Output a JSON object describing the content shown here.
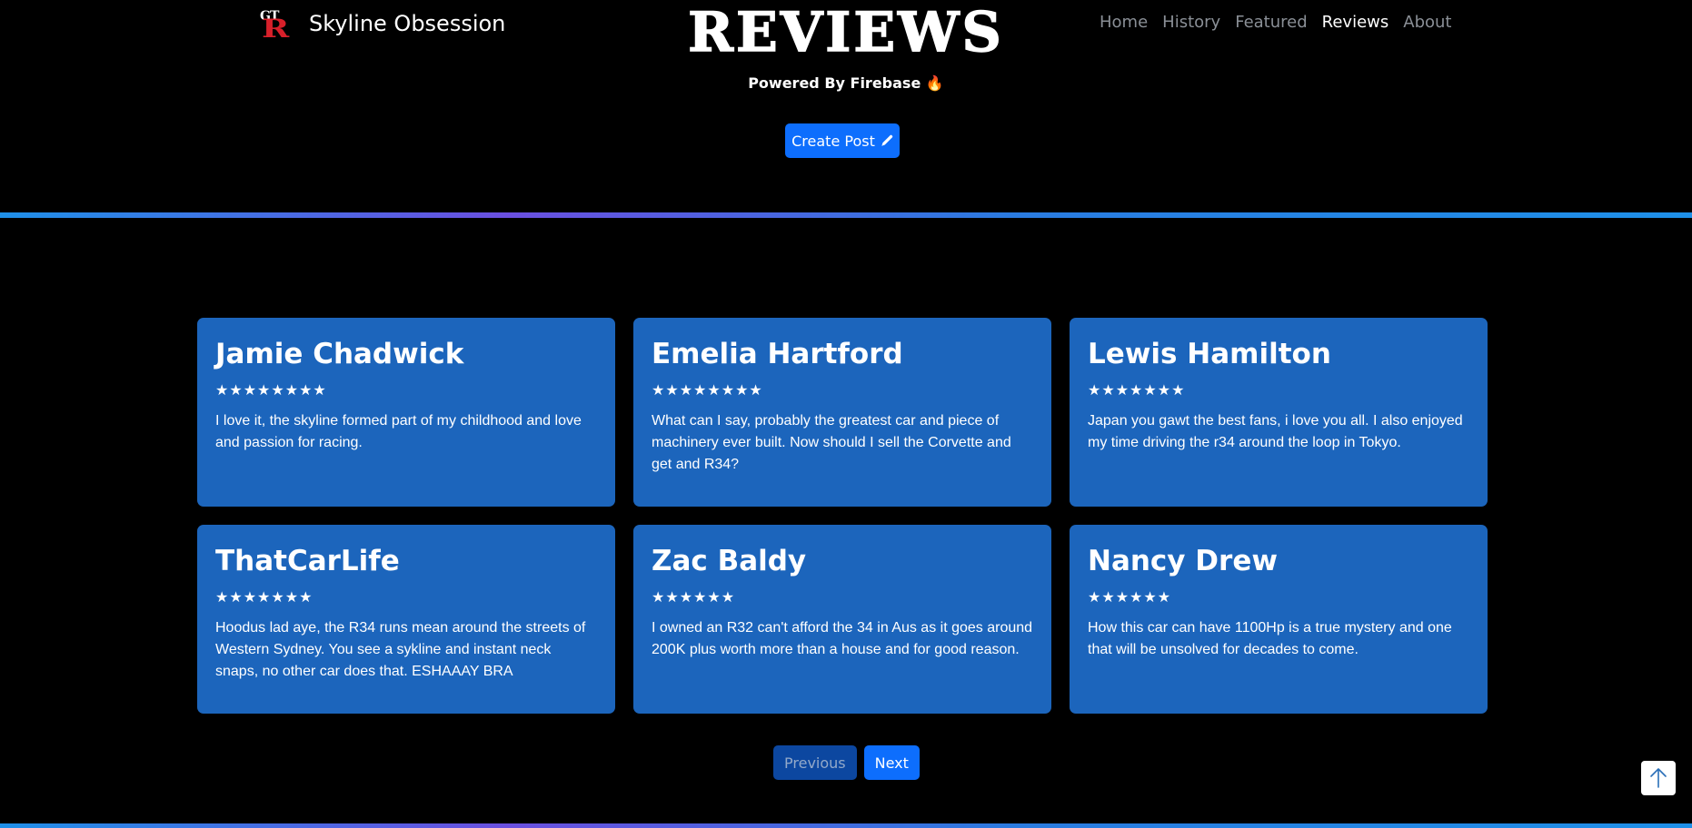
{
  "brand": {
    "logo_top": "GT",
    "logo_bottom": "R",
    "name": "Skyline Obsession"
  },
  "nav": {
    "items": [
      {
        "label": "Home",
        "active": false
      },
      {
        "label": "History",
        "active": false
      },
      {
        "label": "Featured",
        "active": false
      },
      {
        "label": "Reviews",
        "active": true
      },
      {
        "label": "About",
        "active": false
      }
    ]
  },
  "hero": {
    "title": "REVIEWS",
    "powered_by": "Powered By Firebase",
    "powered_icon": "🔥",
    "create_label": "Create Post",
    "create_icon": "pencil-icon"
  },
  "reviews": [
    {
      "name": "Jamie Chadwick",
      "stars": "★★★★★★★★",
      "text": "I love it, the skyline formed part of my childhood and love and passion for racing."
    },
    {
      "name": "Emelia Hartford",
      "stars": "★★★★★★★★",
      "text": "What can I say, probably the greatest car and piece of machinery ever built. Now should I sell the Corvette and get and R34?"
    },
    {
      "name": "Lewis Hamilton",
      "stars": "★★★★★★★",
      "text": "Japan you gawt the best fans, i love you all. I also enjoyed my time driving the r34 around the loop in Tokyo."
    },
    {
      "name": "ThatCarLife",
      "stars": "★★★★★★★",
      "text": "Hoodus lad aye, the R34 runs mean around the streets of Western Sydney. You see a sykline and instant neck snaps, no other car does that. ESHAAAY BRA"
    },
    {
      "name": "Zac Baldy",
      "stars": "★★★★★★",
      "text": "I owned an R32 can't afford the 34 in Aus as it goes around 200K plus worth more than a house and for good reason."
    },
    {
      "name": "Nancy Drew",
      "stars": "★★★★★★",
      "text": "How this car can have 1100Hp is a true mystery and one that will be unsolved for decades to come."
    }
  ],
  "pagination": {
    "previous_label": "Previous",
    "next_label": "Next"
  },
  "colors": {
    "background": "#000000",
    "card": "#1c65bc",
    "primary": "#0d6efd",
    "brand_red": "#d8202a"
  }
}
